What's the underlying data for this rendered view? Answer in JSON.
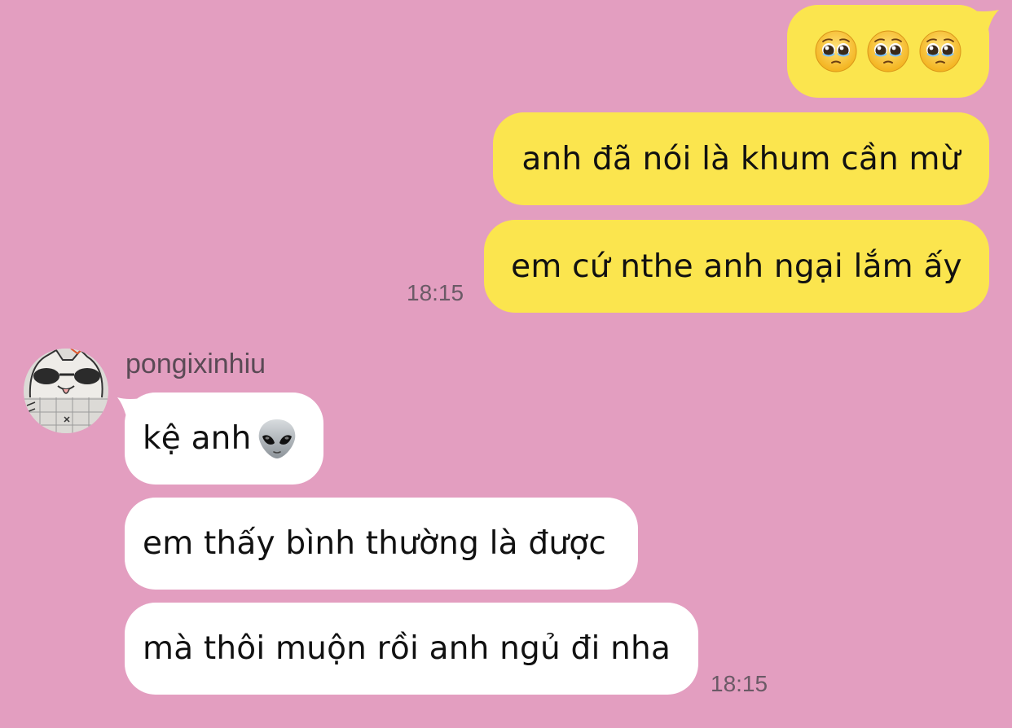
{
  "conversation": {
    "outgoing": {
      "emoji_message": [
        "pleading-face-emoji",
        "pleading-face-emoji",
        "pleading-face-emoji"
      ],
      "messages": [
        "anh đã nói là khum cần mừ",
        "em cứ nthe anh ngại lắm ấy"
      ],
      "timestamp": "18:15"
    },
    "incoming": {
      "sender": "pongixinhiu",
      "messages": [
        "kệ anh",
        "em thấy bình thường là được",
        "mà thôi muộn rồi anh ngủ đi nha"
      ],
      "first_message_emoji": "alien-emoji",
      "timestamp": "18:15"
    }
  },
  "colors": {
    "background": "#e39ec0",
    "outgoing_bubble": "#fbe54e",
    "incoming_bubble": "#ffffff",
    "timestamp_text": "#6b5a66"
  }
}
